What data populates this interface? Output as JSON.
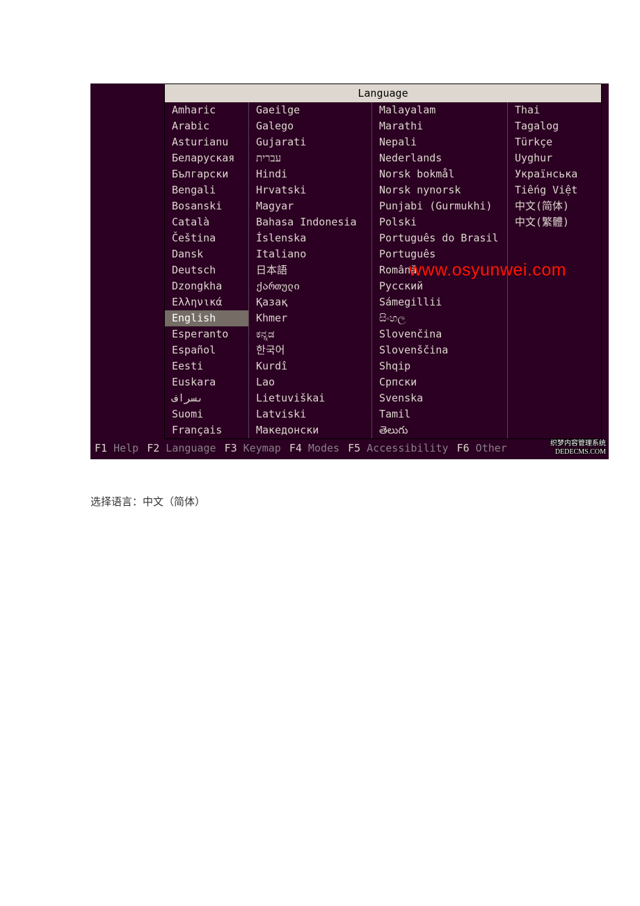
{
  "title": "Language",
  "selected": "English",
  "columns": [
    [
      "Amharic",
      "Arabic",
      "Asturianu",
      "Беларуская",
      "Български",
      "Bengali",
      "Bosanski",
      "Català",
      "Čeština",
      "Dansk",
      "Deutsch",
      "Dzongkha",
      "Ελληνικά",
      "English",
      "Esperanto",
      "Español",
      "Eesti",
      "Euskara",
      "ىسراف",
      "Suomi",
      "Français"
    ],
    [
      "Gaeilge",
      "Galego",
      "Gujarati",
      "עברית",
      "Hindi",
      "Hrvatski",
      "Magyar",
      "Bahasa Indonesia",
      "Íslenska",
      "Italiano",
      "日本語",
      "ქართული",
      "Қазақ",
      "Khmer",
      "ಕನ್ನಡ",
      "한국어",
      "Kurdî",
      "Lao",
      "Lietuviškai",
      "Latviski",
      "Македонски"
    ],
    [
      "Malayalam",
      "Marathi",
      "Nepali",
      "Nederlands",
      "Norsk bokmål",
      "Norsk nynorsk",
      "Punjabi (Gurmukhi)",
      "Polski",
      "Português do Brasil",
      "Português",
      "Română",
      "Русский",
      "Sámegillii",
      "සිංහල",
      "Slovenčina",
      "Slovenščina",
      "Shqip",
      "Српски",
      "Svenska",
      "Tamil",
      "తెలుగు"
    ],
    [
      "Thai",
      "Tagalog",
      "Türkçe",
      "Uyghur",
      "Українська",
      "Tiếng Việt",
      "中文(简体)",
      "中文(繁體)"
    ]
  ],
  "fkeys": [
    {
      "key": "F1",
      "label": "Help"
    },
    {
      "key": "F2",
      "label": "Language"
    },
    {
      "key": "F3",
      "label": "Keymap"
    },
    {
      "key": "F4",
      "label": "Modes"
    },
    {
      "key": "F5",
      "label": "Accessibility"
    },
    {
      "key": "F6",
      "label": "Other"
    }
  ],
  "watermark": "www.osyunwei.com",
  "dedecms_line1": "织梦内容管理系统",
  "dedecms_line2": "DEDECMS.COM",
  "caption": "选择语言：中文（简体）"
}
